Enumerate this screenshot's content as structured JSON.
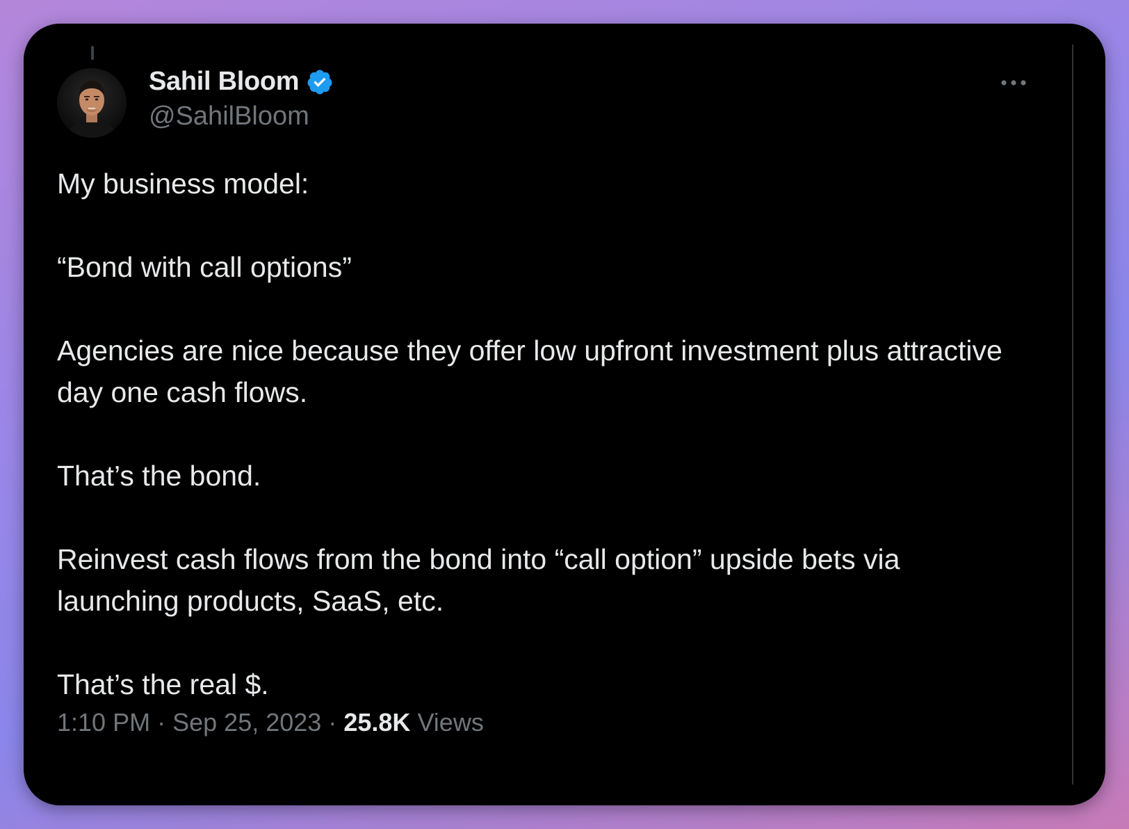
{
  "author": {
    "name": "Sahil Bloom",
    "handle": "@SahilBloom",
    "verified_color": "#1d9bf0"
  },
  "icons": {
    "verified": "verified-badge-icon",
    "more": "more-options-icon"
  },
  "tweet": {
    "paragraphs": [
      "My business model:",
      "“Bond with call options”",
      "Agencies are nice because they offer low upfront investment plus attractive day one cash flows.",
      "That’s the bond.",
      "Reinvest cash flows from the bond into “call option” upside bets via launching products, SaaS, etc.",
      "That’s the real $."
    ]
  },
  "meta": {
    "time": "1:10 PM",
    "separator": "·",
    "date": "Sep 25, 2023",
    "views_count": "25.8K",
    "views_label": "Views"
  },
  "colors": {
    "card_background": "#000000",
    "text_primary": "#e7e9ea",
    "text_secondary": "#71767b"
  }
}
